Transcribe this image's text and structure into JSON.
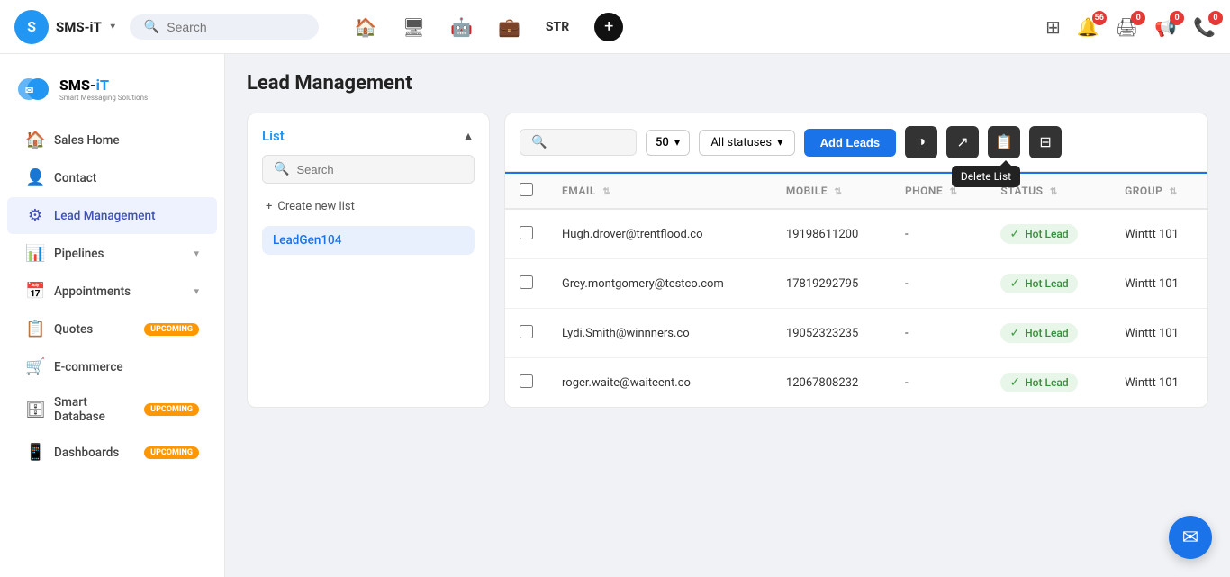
{
  "brand": {
    "initial": "S",
    "name": "SMS-iT",
    "dropdown_arrow": "▾",
    "logo_sub": "Smart Messaging Solutions"
  },
  "top_search": {
    "placeholder": "Search"
  },
  "nav_center": {
    "home_icon": "🏠",
    "monitor_icon": "🖥",
    "robot_icon": "🤖",
    "briefcase_icon": "💼",
    "str_label": "STR",
    "plus_icon": "+"
  },
  "nav_icons": {
    "grid_icon": "⊞",
    "bell_badge": "56",
    "print_badge": "0",
    "speaker_badge": "0",
    "phone_badge": "0"
  },
  "sidebar": {
    "logo_text_black": "SMS-",
    "logo_text_blue": "iT",
    "logo_sub": "Smart Messaging Solutions",
    "items": [
      {
        "id": "sales-home",
        "icon": "🏠",
        "label": "Sales Home",
        "active": false,
        "badge": ""
      },
      {
        "id": "contact",
        "icon": "👤",
        "label": "Contact",
        "active": false,
        "badge": ""
      },
      {
        "id": "lead-management",
        "icon": "⚙",
        "label": "Lead Management",
        "active": true,
        "badge": ""
      },
      {
        "id": "pipelines",
        "icon": "📊",
        "label": "Pipelines",
        "active": false,
        "badge": ""
      },
      {
        "id": "appointments",
        "icon": "📅",
        "label": "Appointments",
        "active": false,
        "badge": ""
      },
      {
        "id": "quotes",
        "icon": "📋",
        "label": "Quotes",
        "active": false,
        "badge": "UPCOMING"
      },
      {
        "id": "ecommerce",
        "icon": "🛒",
        "label": "E-commerce",
        "active": false,
        "badge": ""
      },
      {
        "id": "smart-database",
        "icon": "🗄",
        "label": "Smart Database",
        "active": false,
        "badge": "UPCOMING"
      },
      {
        "id": "dashboards",
        "icon": "📱",
        "label": "Dashboards",
        "active": false,
        "badge": "UPCOMING"
      }
    ]
  },
  "page": {
    "title": "Lead Management"
  },
  "list_panel": {
    "title": "List",
    "search_placeholder": "Search",
    "create_new_list": "Create new list",
    "active_list": "LeadGen104"
  },
  "table_toolbar": {
    "search_placeholder": "",
    "per_page": "50",
    "per_page_arrow": "▾",
    "status_label": "All statuses",
    "status_arrow": "▾",
    "add_leads_btn": "Add Leads",
    "toggle_icon": "◑",
    "export_icon": "↗",
    "delete_list_icon": "📋",
    "columns_icon": "⊟",
    "tooltip_delete": "Delete List"
  },
  "table": {
    "columns": [
      {
        "id": "email",
        "label": "EMAIL"
      },
      {
        "id": "mobile",
        "label": "MOBILE"
      },
      {
        "id": "phone",
        "label": "PHONE"
      },
      {
        "id": "status",
        "label": "STATUS"
      },
      {
        "id": "group",
        "label": "GROUP"
      }
    ],
    "rows": [
      {
        "email": "Hugh.drover@trentflood.co",
        "mobile": "19198611200",
        "phone": "-",
        "status": "Hot Lead",
        "group": "Winttt 101"
      },
      {
        "email": "Grey.montgomery@testco.com",
        "mobile": "17819292795",
        "phone": "-",
        "status": "Hot Lead",
        "group": "Winttt 101"
      },
      {
        "email": "Lydi.Smith@winnners.co",
        "mobile": "19052323235",
        "phone": "-",
        "status": "Hot Lead",
        "group": "Winttt 101"
      },
      {
        "email": "roger.waite@waiteent.co",
        "mobile": "12067808232",
        "phone": "-",
        "status": "Hot Lead",
        "group": "Winttt 101"
      }
    ]
  },
  "chat_bubble": {
    "icon": "✉"
  }
}
